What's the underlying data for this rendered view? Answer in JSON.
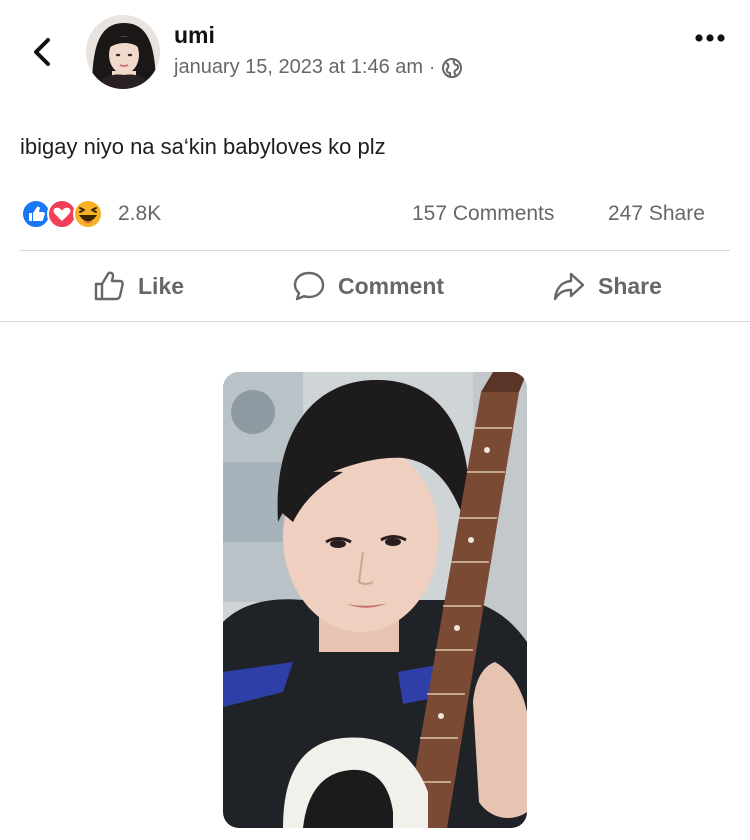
{
  "post": {
    "author": "umi",
    "timestamp": "january 15, 2023 at 1:46 am",
    "separator": "·",
    "privacy_icon": "globe-icon",
    "text": "ibigay niyo na sa‘kin babyloves ko plz"
  },
  "stats": {
    "reaction_icons": [
      "like-reaction-icon",
      "love-reaction-icon",
      "haha-reaction-icon"
    ],
    "reactions": "2.8K",
    "comments": "157 Comments",
    "shares": "247 Share"
  },
  "actions": {
    "like_label": "Like",
    "comment_label": "Comment",
    "share_label": "Share"
  },
  "colors": {
    "like_blue": "#1877f2",
    "love_red": "#f33e58",
    "haha_yellow": "#f7b125",
    "muted_text": "#65676b",
    "divider": "#d8d8d8"
  }
}
